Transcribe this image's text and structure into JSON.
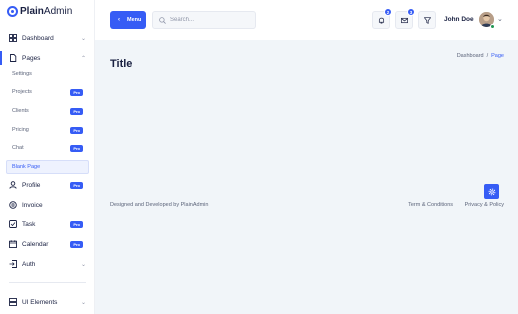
{
  "brand": {
    "name_bold": "Plain",
    "name_rest": "Admin"
  },
  "sidebar": {
    "items": [
      {
        "label": "Dashboard",
        "icon": "grid-icon",
        "chevron": "down"
      },
      {
        "label": "Pages",
        "icon": "page-icon",
        "chevron": "up"
      },
      {
        "label": "Profile",
        "icon": "user-icon",
        "badge": "Pro"
      },
      {
        "label": "Invoice",
        "icon": "invoice-icon"
      },
      {
        "label": "Task",
        "icon": "task-icon",
        "badge": "Pro"
      },
      {
        "label": "Calendar",
        "icon": "calendar-icon",
        "badge": "Pro"
      },
      {
        "label": "Auth",
        "icon": "auth-icon",
        "chevron": "down"
      },
      {
        "label": "UI Elements",
        "icon": "layers-icon",
        "chevron": "down"
      }
    ],
    "sub_items": [
      {
        "label": "Settings"
      },
      {
        "label": "Projects",
        "badge": "Pro"
      },
      {
        "label": "Clients",
        "badge": "Pro"
      },
      {
        "label": "Pricing",
        "badge": "Pro"
      },
      {
        "label": "Chat",
        "badge": "Pro"
      },
      {
        "label": "Blank Page"
      }
    ]
  },
  "header": {
    "menu_label": "Menu",
    "search_placeholder": "Search...",
    "notifications_count": "2",
    "messages_count": "3",
    "user_name": "John Doe"
  },
  "main": {
    "title": "Title",
    "breadcrumb": {
      "parent": "Dashboard",
      "separator": "/",
      "current": "Page"
    }
  },
  "footer": {
    "credit": "Designed and Developed by PlainAdmin",
    "terms": "Term & Conditions",
    "privacy": "Privacy & Policy"
  },
  "colors": {
    "accent": "#365cf5",
    "text": "#1a2142",
    "background": "#f1f5f9"
  }
}
